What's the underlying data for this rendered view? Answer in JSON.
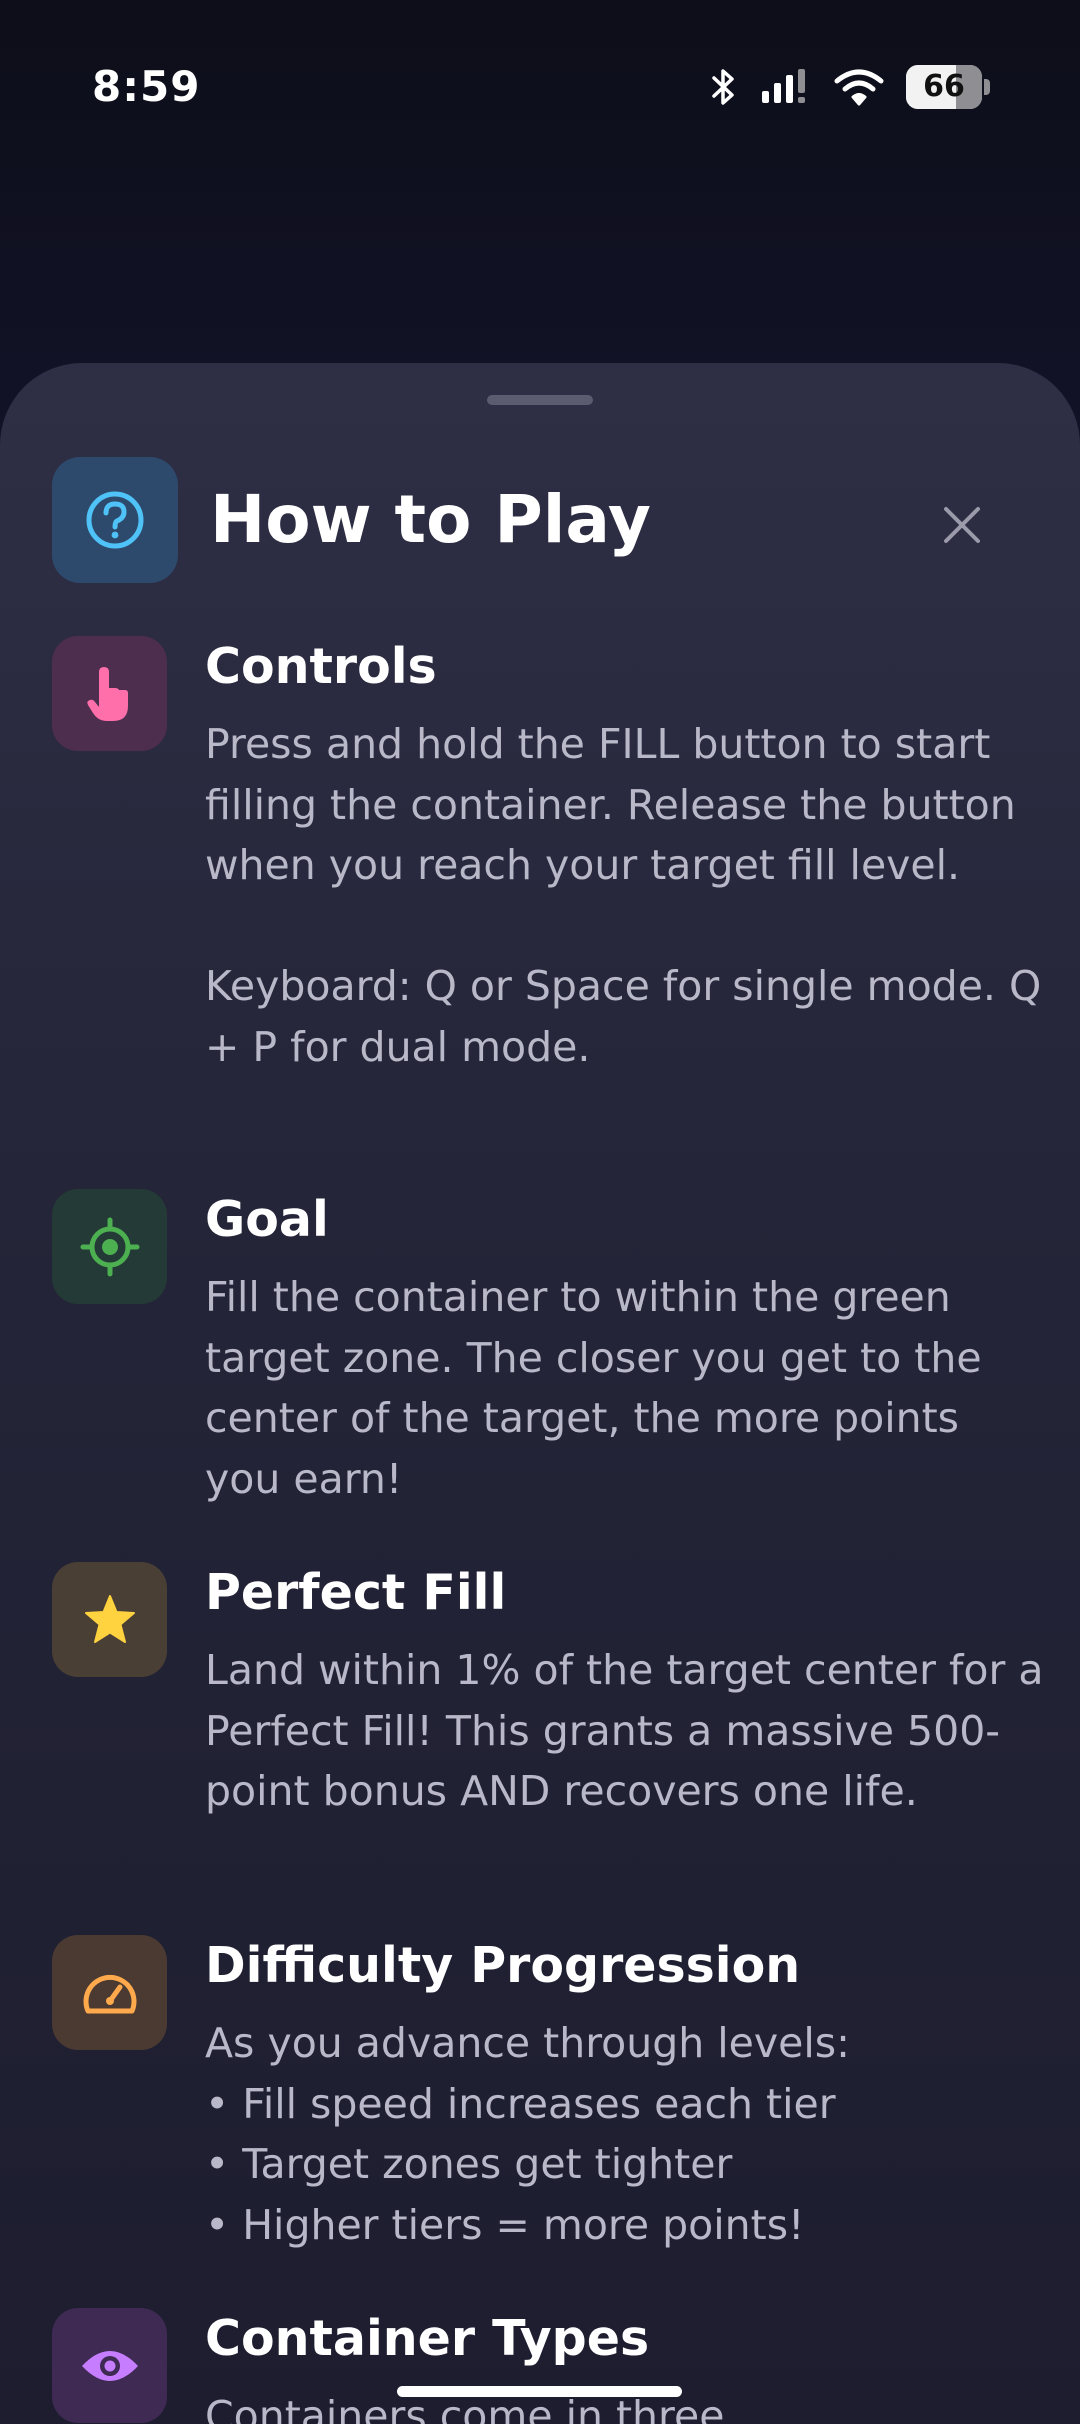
{
  "status_bar": {
    "time": "8:59",
    "battery_level": "66",
    "icons": [
      "bluetooth-icon",
      "signal-icon",
      "wifi-icon",
      "battery-icon"
    ]
  },
  "sheet": {
    "title": "How to Play",
    "header_icon": "question-circle-icon",
    "close_icon": "close-icon",
    "sections": [
      {
        "title": "Controls",
        "icon": "touch-hand-icon",
        "icon_bg": "#4e2e4f",
        "icon_color": "#ff6fa9",
        "body": "Press and hold the FILL button to start filling the container. Release the button when you reach your target fill level.\n\nKeyboard: Q or Space for single mode. Q + P for dual mode."
      },
      {
        "title": "Goal",
        "icon": "target-icon",
        "icon_bg": "#243a36",
        "icon_color": "#4caf50",
        "body": "Fill the container to within the green target zone. The closer you get to the center of the target, the more points you earn!"
      },
      {
        "title": "Perfect Fill",
        "icon": "star-icon",
        "icon_bg": "#4a3f34",
        "icon_color": "#ffd23f",
        "body": "Land within 1% of the target center for a Perfect Fill! This grants a massive 500-point bonus AND recovers one life."
      },
      {
        "title": "Difficulty Progression",
        "icon": "speedometer-icon",
        "icon_bg": "#4b3a32",
        "icon_color": "#ffa94d",
        "body": "As you advance through levels:\n• Fill speed increases each tier\n• Target zones get tighter\n• Higher tiers = more points!"
      },
      {
        "title": "Container Types",
        "icon": "eye-icon",
        "icon_bg": "#3e2a52",
        "icon_color": "#c77dff",
        "body": "Containers come in three"
      }
    ]
  }
}
